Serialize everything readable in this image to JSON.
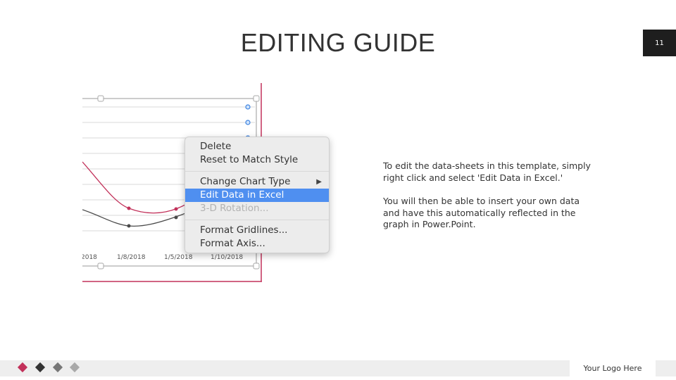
{
  "slide": {
    "title": "EDITING GUIDE",
    "page_number": "11"
  },
  "chart_screenshot": {
    "x_tick_labels": [
      "2018",
      "1/8/2018",
      "1/5/2018",
      "1/10/2018"
    ],
    "series_colors": {
      "series1": "#c2315a",
      "series2": "#4a4a4a"
    }
  },
  "context_menu": {
    "items": [
      {
        "label": "Delete",
        "state": "normal"
      },
      {
        "label": "Reset to Match Style",
        "state": "normal"
      },
      {
        "label": "Change Chart Type",
        "state": "normal",
        "submenu": true
      },
      {
        "label": "Edit Data in Excel",
        "state": "selected"
      },
      {
        "label": "3-D Rotation...",
        "state": "disabled"
      },
      {
        "label": "Format Gridlines...",
        "state": "normal"
      },
      {
        "label": "Format Axis...",
        "state": "normal"
      }
    ],
    "submenu_icon": "triangle-right-icon"
  },
  "instructions": {
    "paragraph1": "To edit the data-sheets in this template, simply right click and select 'Edit Data in Excel.'",
    "paragraph2": "You will then be able to insert your own data and have this automatically reflected in the graph in Power.Point."
  },
  "footer": {
    "logo_text": "Your Logo Here",
    "diamond_colors": [
      "#c2315a",
      "#333333",
      "#777777",
      "#a9a9a9"
    ]
  }
}
